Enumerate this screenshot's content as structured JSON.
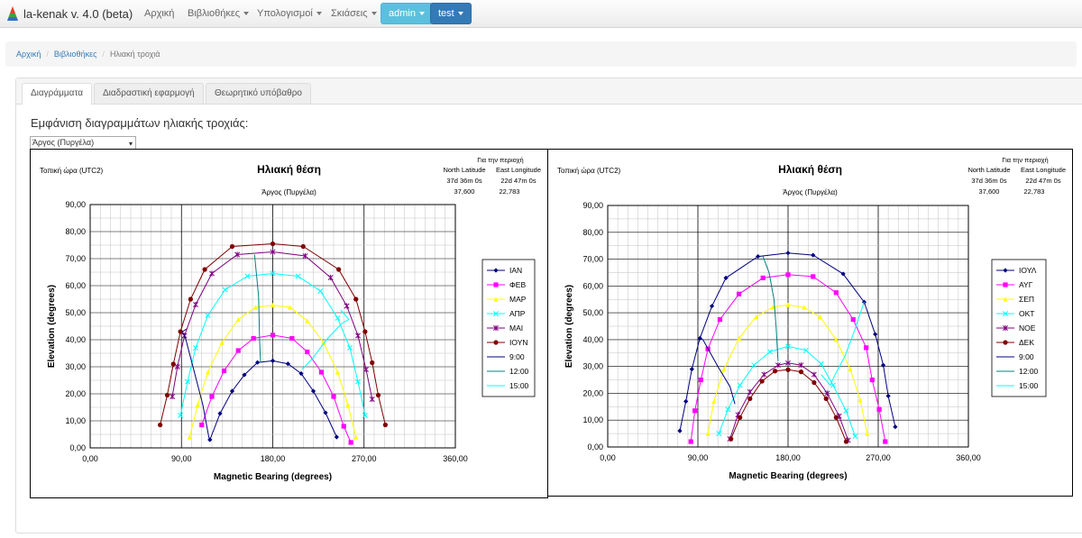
{
  "navbar": {
    "brand": "la-kenak v. 4.0 (beta)",
    "items": [
      "Αρχική",
      "Βιβλιοθήκες",
      "Υπολογισμοί",
      "Σκιάσεις"
    ],
    "user_button": "admin",
    "test_button": "test"
  },
  "breadcrumb": {
    "home": "Αρχική",
    "libraries": "Βιβλιοθήκες",
    "current": "Ηλιακή τροχιά"
  },
  "tabs": [
    "Διαγράμματα",
    "Διαδραστική εφαρμογή",
    "Θεωρητικό υπόβαθρο"
  ],
  "heading": "Εμφάνιση διαγραμμάτων ηλιακής τροχιάς:",
  "location_select": "Άργος (Πυργέλα)",
  "colors": {
    "accent_info": "#5bc0de",
    "accent_primary": "#337ab7"
  },
  "chart_data": [
    {
      "type": "line",
      "title": "Ηλιακή θέση",
      "subtitle": "Άργος (Πυργέλα)",
      "local_time": "Τοπική ώρα (UTC2)",
      "info": {
        "header": "Για την περιοχή",
        "lat_label": "North Latitude",
        "lon_label": "East Longitude",
        "lat_dms": "37d 36m 0s",
        "lon_dms": "22d 47m 0s",
        "lat": "37,600",
        "lon": "22,783"
      },
      "xlabel": "Magnetic Bearing (degrees)",
      "ylabel": "Elevation (degrees)",
      "xlim": [
        0,
        360
      ],
      "ylim": [
        0,
        90
      ],
      "xticks": [
        "0,00",
        "90,00",
        "180,00",
        "270,00",
        "360,00"
      ],
      "yticks": [
        "0,00",
        "10,00",
        "20,00",
        "30,00",
        "40,00",
        "50,00",
        "60,00",
        "70,00",
        "80,00",
        "90,00"
      ],
      "legend_position": "right",
      "grid": true,
      "series": [
        {
          "name": "ΙΑΝ",
          "color": "#000080",
          "marker": "diamond",
          "points": [
            [
              118,
              3
            ],
            [
              128,
              12.7
            ],
            [
              140,
              21
            ],
            [
              152,
              27
            ],
            [
              165,
              31.6
            ],
            [
              180,
              32.2
            ],
            [
              195,
              31.1
            ],
            [
              208,
              27.5
            ],
            [
              220,
              21
            ],
            [
              232,
              13
            ],
            [
              243,
              4
            ]
          ]
        },
        {
          "name": "ΦΕΒ",
          "color": "#ff00ff",
          "marker": "square",
          "points": [
            [
              110,
              8.5
            ],
            [
              120,
              19
            ],
            [
              132,
              28.5
            ],
            [
              146,
              36
            ],
            [
              161,
              40.5
            ],
            [
              180,
              41.7
            ],
            [
              199,
              40.5
            ],
            [
              214,
              35.5
            ],
            [
              228,
              28
            ],
            [
              240,
              19
            ],
            [
              250,
              8
            ],
            [
              257,
              2
            ]
          ]
        },
        {
          "name": "ΜΑΡ",
          "color": "#ffff00",
          "marker": "triangle",
          "points": [
            [
              98,
              4
            ],
            [
              106,
              16
            ],
            [
              116,
              28
            ],
            [
              130,
              39
            ],
            [
              146,
              47.5
            ],
            [
              163,
              52
            ],
            [
              180,
              52.8
            ],
            [
              197,
              52
            ],
            [
              214,
              47
            ],
            [
              230,
              39
            ],
            [
              244,
              28
            ],
            [
              254,
              16
            ],
            [
              262,
              4
            ]
          ]
        },
        {
          "name": "ΑΠΡ",
          "color": "#00ffff",
          "marker": "x",
          "points": [
            [
              89,
              12
            ],
            [
              96,
              24.5
            ],
            [
              104,
              37
            ],
            [
              116,
              49
            ],
            [
              133,
              58.5
            ],
            [
              155,
              63.5
            ],
            [
              180,
              64.5
            ],
            [
              205,
              63.5
            ],
            [
              227,
              58
            ],
            [
              244,
              48
            ],
            [
              256,
              37
            ],
            [
              264,
              24.5
            ],
            [
              271,
              12
            ]
          ]
        },
        {
          "name": "ΜΑΙ",
          "color": "#800080",
          "marker": "star",
          "points": [
            [
              81,
              19
            ],
            [
              86,
              30
            ],
            [
              93,
              41.5
            ],
            [
              104,
              53
            ],
            [
              120,
              64.5
            ],
            [
              145,
              71.5
            ],
            [
              180,
              72.5
            ],
            [
              212,
              71
            ],
            [
              237,
              63
            ],
            [
              253,
              52.5
            ],
            [
              264,
              41.5
            ],
            [
              272,
              29
            ],
            [
              278,
              18
            ]
          ]
        },
        {
          "name": "ΙΟΥΝ",
          "color": "#800000",
          "marker": "circle",
          "points": [
            [
              69,
              8.5
            ],
            [
              76,
              19.5
            ],
            [
              82,
              31
            ],
            [
              89,
              43
            ],
            [
              99,
              55
            ],
            [
              113,
              66
            ],
            [
              140,
              74.5
            ],
            [
              180,
              75.5
            ],
            [
              210,
              74.5
            ],
            [
              245,
              66
            ],
            [
              262,
              55
            ],
            [
              271,
              43
            ],
            [
              278,
              31.5
            ],
            [
              284,
              19.5
            ],
            [
              291,
              8.5
            ]
          ]
        }
      ],
      "hour_lines": [
        {
          "name": "9:00",
          "color": "#000080",
          "points": [
            [
              118,
              3
            ],
            [
              117,
              4
            ],
            [
              111,
              16
            ],
            [
              102,
              29
            ],
            [
              94,
              40.5
            ],
            [
              91,
              43
            ],
            [
              95,
              44
            ]
          ]
        },
        {
          "name": "12:00",
          "color": "#008080",
          "points": [
            [
              168,
              31.5
            ],
            [
              167,
              40
            ],
            [
              166,
              56
            ],
            [
              164,
              64
            ],
            [
              162,
              71.5
            ]
          ]
        },
        {
          "name": "15:00",
          "color": "#00ffff",
          "points": [
            [
              209,
              29
            ],
            [
              219,
              33
            ],
            [
              233,
              40
            ],
            [
              248,
              46
            ],
            [
              255,
              47.5
            ],
            [
              247,
              51
            ]
          ]
        }
      ]
    },
    {
      "type": "line",
      "title": "Ηλιακή θέση",
      "subtitle": "Άργος (Πυργέλα)",
      "local_time": "Τοπική ώρα (UTC2)",
      "info": {
        "header": "Για την περιοχή",
        "lat_label": "North Latitude",
        "lon_label": "East Longitude",
        "lat_dms": "37d 36m 0s",
        "lon_dms": "22d 47m 0s",
        "lat": "37,600",
        "lon": "22,783"
      },
      "xlabel": "Magnetic Bearing (degrees)",
      "ylabel": "Elevation (degrees)",
      "xlim": [
        0,
        360
      ],
      "ylim": [
        0,
        90
      ],
      "xticks": [
        "0,00",
        "90,00",
        "180,00",
        "270,00",
        "360,00"
      ],
      "yticks": [
        "0,00",
        "10,00",
        "20,00",
        "30,00",
        "40,00",
        "50,00",
        "60,00",
        "70,00",
        "80,00",
        "90,00"
      ],
      "legend_position": "right",
      "grid": true,
      "series": [
        {
          "name": "ΙΟΥΛ",
          "color": "#000080",
          "marker": "diamond",
          "points": [
            [
              72,
              6
            ],
            [
              78,
              17
            ],
            [
              84,
              29
            ],
            [
              92,
              40.5
            ],
            [
              104,
              52.5
            ],
            [
              118,
              63
            ],
            [
              150,
              71
            ],
            [
              180,
              72.3
            ],
            [
              205,
              71.5
            ],
            [
              235,
              64.5
            ],
            [
              256,
              54
            ],
            [
              267,
              42
            ],
            [
              275,
              30.5
            ],
            [
              280,
              19
            ],
            [
              287,
              7.5
            ]
          ]
        },
        {
          "name": "ΑΥΓ",
          "color": "#ff00ff",
          "marker": "square",
          "points": [
            [
              83,
              2
            ],
            [
              87,
              13.5
            ],
            [
              93,
              25
            ],
            [
              100,
              36.5
            ],
            [
              112,
              47.5
            ],
            [
              131,
              57
            ],
            [
              155,
              63
            ],
            [
              180,
              64.2
            ],
            [
              205,
              63.5
            ],
            [
              228,
              57.5
            ],
            [
              245,
              47.5
            ],
            [
              258,
              37
            ],
            [
              264,
              25
            ],
            [
              271,
              14
            ],
            [
              277,
              2
            ]
          ]
        },
        {
          "name": "ΣΕΠ",
          "color": "#ffff00",
          "marker": "triangle",
          "points": [
            [
              100,
              5
            ],
            [
              106,
              17
            ],
            [
              116,
              29
            ],
            [
              131,
              40.5
            ],
            [
              148,
              48.5
            ],
            [
              165,
              52.2
            ],
            [
              180,
              53
            ],
            [
              196,
              52
            ],
            [
              212,
              48.5
            ],
            [
              228,
              40
            ],
            [
              242,
              29
            ],
            [
              252,
              17.5
            ],
            [
              259,
              5
            ]
          ]
        },
        {
          "name": "ΟΚΤ",
          "color": "#00ffff",
          "marker": "x",
          "points": [
            [
              111,
              5
            ],
            [
              120,
              14
            ],
            [
              132,
              23
            ],
            [
              146,
              30.5
            ],
            [
              162,
              35.5
            ],
            [
              180,
              37.5
            ],
            [
              198,
              36
            ],
            [
              213,
              31
            ],
            [
              225,
              23
            ],
            [
              238,
              13.5
            ],
            [
              247,
              4
            ]
          ]
        },
        {
          "name": "ΝΟΕ",
          "color": "#800080",
          "marker": "star",
          "points": [
            [
              122,
              3
            ],
            [
              130,
              12
            ],
            [
              142,
              20.5
            ],
            [
              156,
              27
            ],
            [
              170,
              30.5
            ],
            [
              180,
              31.3
            ],
            [
              193,
              30.5
            ],
            [
              206,
              27
            ],
            [
              219,
              20
            ],
            [
              231,
              11.5
            ],
            [
              240,
              2.5
            ]
          ]
        },
        {
          "name": "ΔΕΚ",
          "color": "#800000",
          "marker": "circle",
          "points": [
            [
              123,
              3
            ],
            [
              132,
              11
            ],
            [
              142,
              18
            ],
            [
              154,
              24.5
            ],
            [
              167,
              28.3
            ],
            [
              180,
              28.8
            ],
            [
              193,
              28
            ],
            [
              206,
              24
            ],
            [
              218,
              18
            ],
            [
              228,
              11
            ],
            [
              238,
              2
            ]
          ]
        }
      ],
      "hour_lines": [
        {
          "name": "9:00",
          "color": "#000080",
          "points": [
            [
              92,
              40.5
            ],
            [
              95,
              40
            ],
            [
              101,
              36
            ],
            [
              110,
              30
            ],
            [
              122,
              22.5
            ],
            [
              127,
              16
            ]
          ]
        },
        {
          "name": "12:00",
          "color": "#008080",
          "points": [
            [
              155,
              71
            ],
            [
              161,
              65
            ],
            [
              166,
              55
            ],
            [
              168,
              45
            ],
            [
              170,
              32
            ]
          ]
        },
        {
          "name": "15:00",
          "color": "#00ffff",
          "points": [
            [
              213,
              27
            ],
            [
              222,
              23
            ],
            [
              227,
              27
            ],
            [
              237,
              34
            ],
            [
              246,
              43
            ],
            [
              255,
              53
            ],
            [
              256,
              54
            ]
          ]
        }
      ]
    }
  ]
}
